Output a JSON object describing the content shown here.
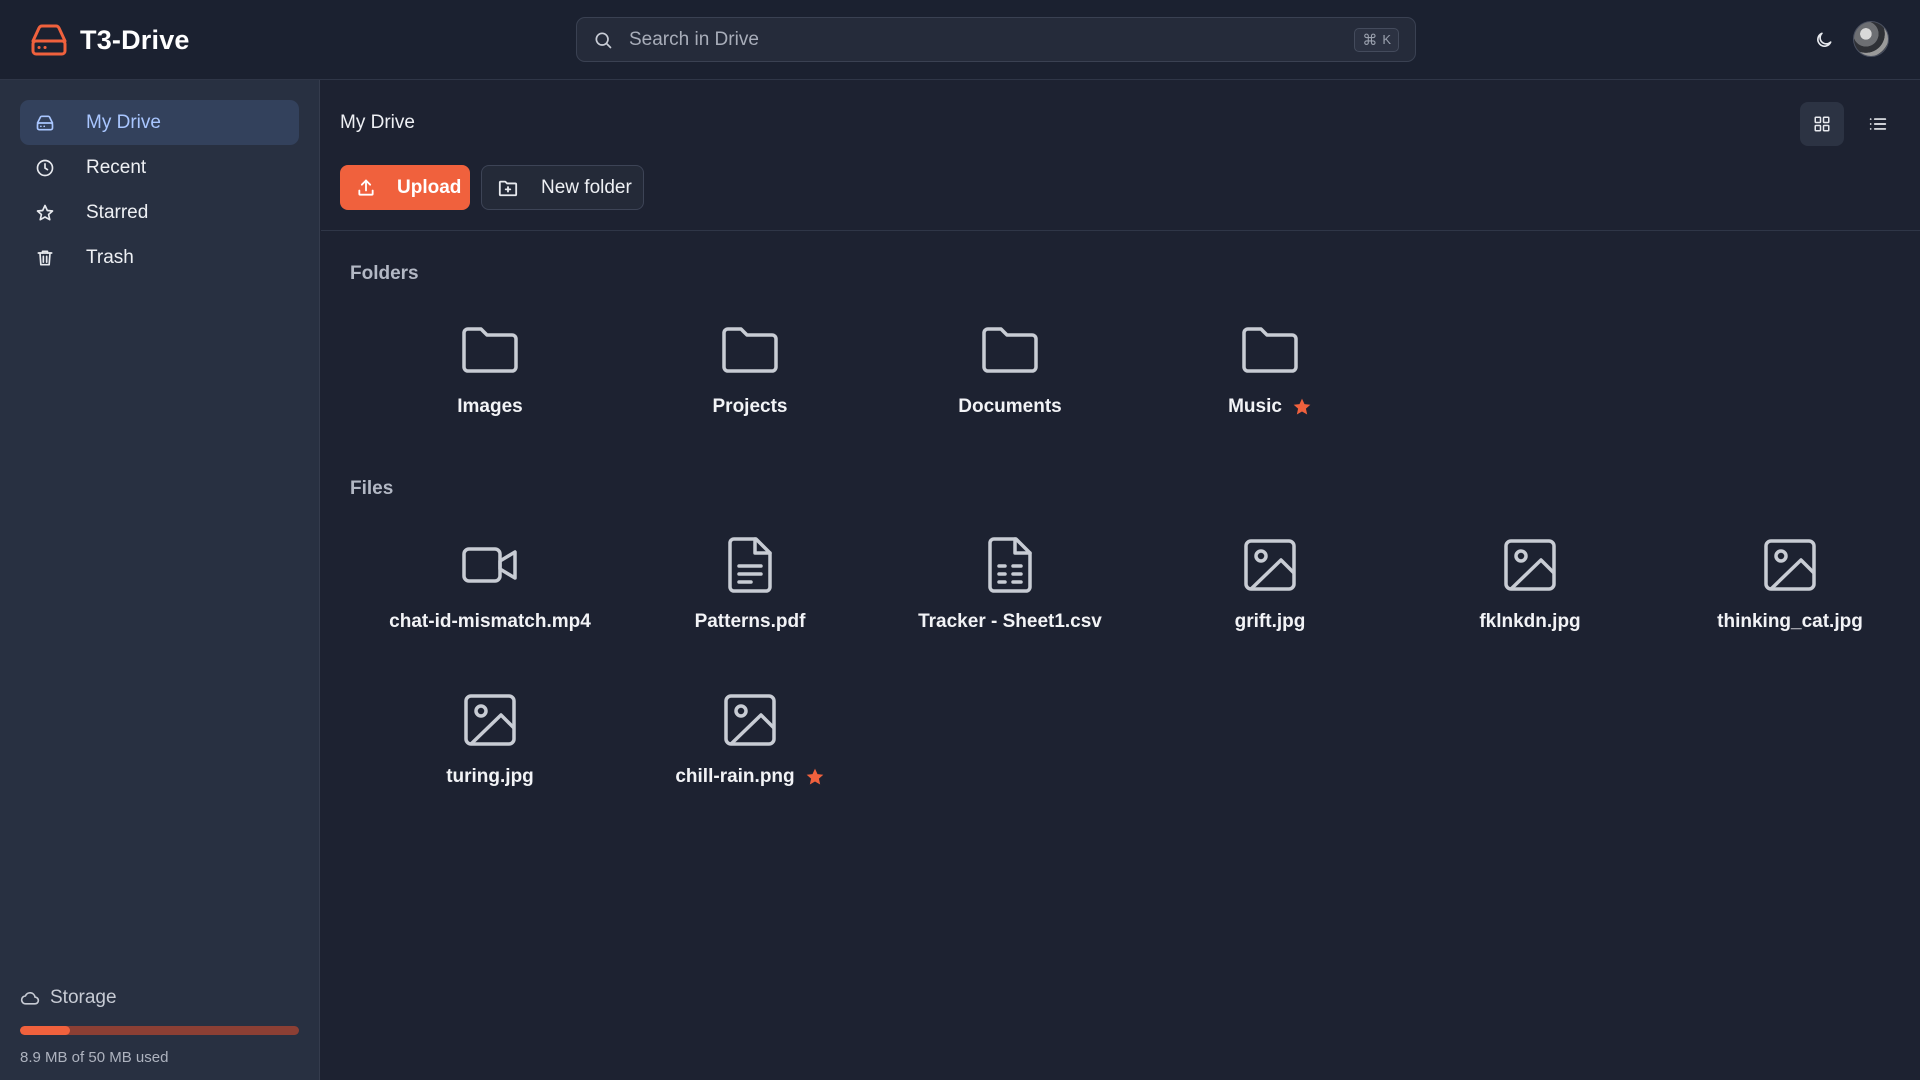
{
  "app": {
    "title": "T3-Drive",
    "logo_icon": "hard-drive-icon",
    "accent": "#f0613d"
  },
  "search": {
    "placeholder": "Search in Drive",
    "shortcut_cmd": "⌘",
    "shortcut_key": "K"
  },
  "header": {
    "theme_icon": "moon-icon",
    "avatar": "user-avatar"
  },
  "sidebar": {
    "items": [
      {
        "label": "My Drive",
        "icon": "hard-drive-icon",
        "active": true
      },
      {
        "label": "Recent",
        "icon": "clock-icon",
        "active": false
      },
      {
        "label": "Starred",
        "icon": "star-icon",
        "active": false
      },
      {
        "label": "Trash",
        "icon": "trash-icon",
        "active": false
      }
    ],
    "storage": {
      "title": "Storage",
      "icon": "cloud-icon",
      "used_text": "8.9 MB of 50 MB used",
      "used_fraction": 0.178
    }
  },
  "main": {
    "breadcrumb": "My Drive",
    "view_icons": [
      "grid-view-icon",
      "list-view-icon"
    ],
    "upload_label": "Upload",
    "new_folder_label": "New folder",
    "folders_title": "Folders",
    "files_title": "Files",
    "folders": [
      {
        "name": "Images",
        "starred": false
      },
      {
        "name": "Projects",
        "starred": false
      },
      {
        "name": "Documents",
        "starred": false
      },
      {
        "name": "Music",
        "starred": true
      }
    ],
    "files": [
      {
        "name": "chat-id-mismatch.mp4",
        "icon": "video-icon",
        "starred": false
      },
      {
        "name": "Patterns.pdf",
        "icon": "document-icon",
        "starred": false
      },
      {
        "name": "Tracker - Sheet1.csv",
        "icon": "spreadsheet-icon",
        "starred": false
      },
      {
        "name": "grift.jpg",
        "icon": "image-icon",
        "starred": false
      },
      {
        "name": "fklnkdn.jpg",
        "icon": "image-icon",
        "starred": false
      },
      {
        "name": "thinking_cat.jpg",
        "icon": "image-icon",
        "starred": false
      },
      {
        "name": "turing.jpg",
        "icon": "image-icon",
        "starred": false
      },
      {
        "name": "chill-rain.png",
        "icon": "image-icon",
        "starred": true
      }
    ]
  }
}
